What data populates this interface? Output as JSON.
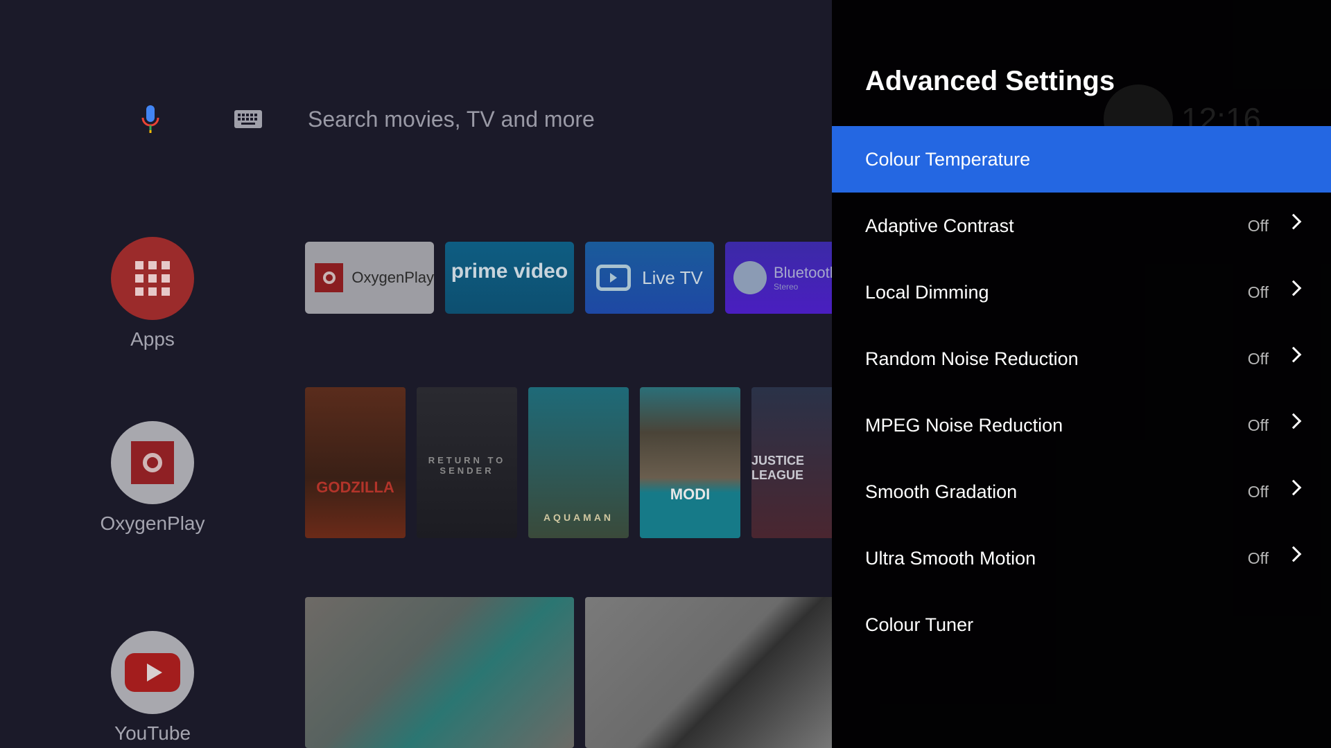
{
  "search": {
    "placeholder": "Search movies, TV and more",
    "mic_icon": "mic-icon",
    "keyboard_icon": "keyboard-icon"
  },
  "sidebar": [
    {
      "label": "Apps",
      "icon": "grid-icon"
    },
    {
      "label": "OxygenPlay",
      "icon": "oxygenplay-icon"
    },
    {
      "label": "YouTube",
      "icon": "youtube-icon"
    }
  ],
  "app_tiles": [
    {
      "label": "OxygenPlay"
    },
    {
      "label": "prime video"
    },
    {
      "label": "Live TV"
    },
    {
      "label": "Bluetooth",
      "sub": "Stereo"
    }
  ],
  "posters": [
    {
      "label": "GODZILLA"
    },
    {
      "label": "RETURN TO SENDER"
    },
    {
      "label": "AQUAMAN"
    },
    {
      "label": "MODI"
    },
    {
      "label": "JUSTICE LEAGUE"
    }
  ],
  "status": {
    "time": "12:16"
  },
  "panel": {
    "title": "Advanced Settings",
    "accent": "#2467e2",
    "items": [
      {
        "label": "Colour Temperature",
        "value": null,
        "selected": true
      },
      {
        "label": "Adaptive Contrast",
        "value": "Off"
      },
      {
        "label": "Local Dimming",
        "value": "Off"
      },
      {
        "label": "Random Noise Reduction",
        "value": "Off"
      },
      {
        "label": "MPEG Noise Reduction",
        "value": "Off"
      },
      {
        "label": "Smooth Gradation",
        "value": "Off"
      },
      {
        "label": "Ultra Smooth Motion",
        "value": "Off"
      },
      {
        "label": "Colour Tuner",
        "value": null
      }
    ]
  }
}
